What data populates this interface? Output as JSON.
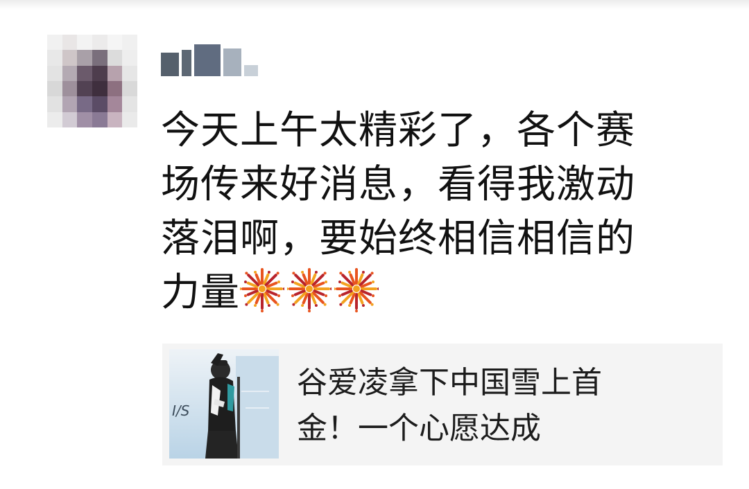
{
  "post": {
    "avatar_icon": "avatar-pixelated",
    "username_icon": "username-pixelated",
    "message_lines": [
      "今天上午太精彩了，各个赛",
      "场传来好消息，看得我激动",
      "落泪啊，要始终相信相信的",
      "力量"
    ],
    "emoji": [
      "fireworks-icon",
      "fireworks-icon",
      "fireworks-icon"
    ],
    "emoji_colors": [
      "#e8541f",
      "#f3a21f",
      "#b8242c"
    ]
  },
  "link_card": {
    "thumbnail_icon": "athlete-photo",
    "thumbnail_text": "I/S",
    "title_lines": [
      "谷爱凌拿下中国雪上首",
      "金！一个心愿达成"
    ],
    "background": "#f4f4f4"
  }
}
